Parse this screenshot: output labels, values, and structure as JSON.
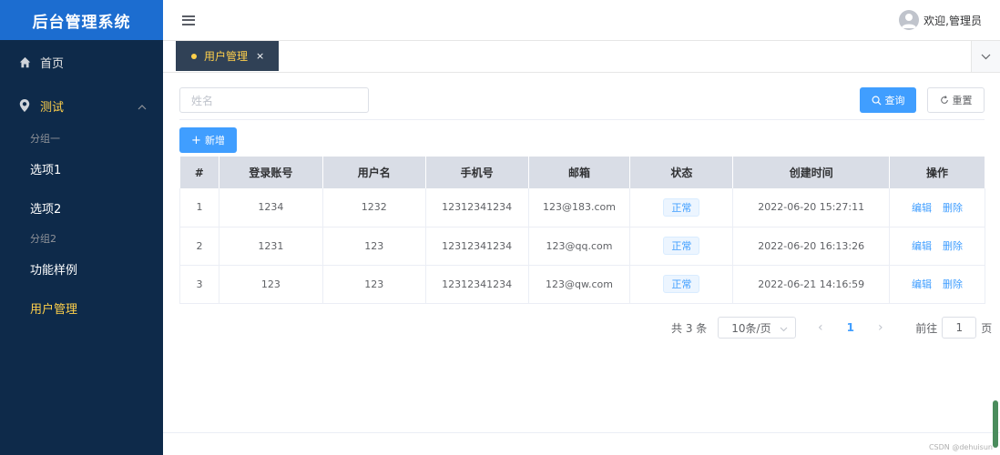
{
  "app": {
    "logo": "后台管理系统"
  },
  "sidebar": {
    "home": "首页",
    "test": "测试",
    "group1": "分组一",
    "option1": "选项1",
    "option2": "选项2",
    "group2": "分组2",
    "feature": "功能样例",
    "user_mgmt": "用户管理"
  },
  "header": {
    "welcome": "欢迎,管理员"
  },
  "tabs": [
    {
      "label": "用户管理",
      "close": "×"
    }
  ],
  "search": {
    "placeholder": "姓名",
    "query_label": "查询",
    "reset_label": "重置",
    "add_label": "新增"
  },
  "table": {
    "columns": [
      "#",
      "登录账号",
      "用户名",
      "手机号",
      "邮箱",
      "状态",
      "创建时间",
      "操作"
    ],
    "rows": [
      {
        "index": "1",
        "account": "1234",
        "username": "1232",
        "phone": "12312341234",
        "email": "123@183.com",
        "status": "正常",
        "created": "2022-06-20 15:27:11",
        "edit": "编辑",
        "delete": "删除"
      },
      {
        "index": "2",
        "account": "1231",
        "username": "123",
        "phone": "12312341234",
        "email": "123@qq.com",
        "status": "正常",
        "created": "2022-06-20 16:13:26",
        "edit": "编辑",
        "delete": "删除"
      },
      {
        "index": "3",
        "account": "123",
        "username": "123",
        "phone": "12312341234",
        "email": "123@qw.com",
        "status": "正常",
        "created": "2022-06-21 14:16:59",
        "edit": "编辑",
        "delete": "删除"
      }
    ]
  },
  "pagination": {
    "total": "共 3 条",
    "page_size": "10条/页",
    "prev": "‹",
    "current": "1",
    "next": "›",
    "goto_prefix": "前往",
    "goto_value": "1",
    "goto_suffix": "页"
  },
  "watermark": "CSDN @dehuisun"
}
